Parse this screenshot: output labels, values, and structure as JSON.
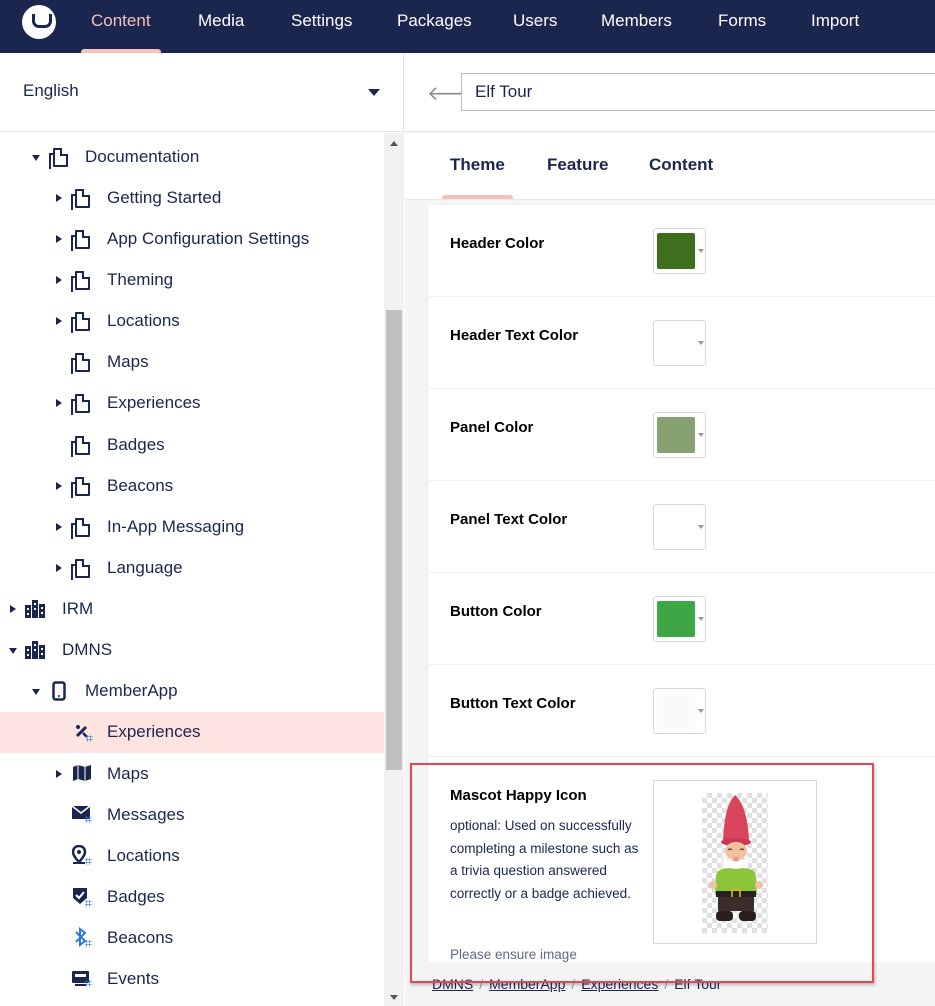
{
  "topnav": {
    "items": [
      "Content",
      "Media",
      "Settings",
      "Packages",
      "Users",
      "Members",
      "Forms",
      "Import"
    ],
    "active": "Content"
  },
  "sidebar": {
    "language": "English",
    "tree": [
      {
        "label": "Documentation",
        "icon": "document-icon",
        "expanded": true
      },
      {
        "label": "Getting Started",
        "icon": "document-icon",
        "has_children": true
      },
      {
        "label": "App Configuration Settings",
        "icon": "document-icon",
        "has_children": true
      },
      {
        "label": "Theming",
        "icon": "document-icon",
        "has_children": true
      },
      {
        "label": "Locations",
        "icon": "document-icon",
        "has_children": true
      },
      {
        "label": "Maps",
        "icon": "document-icon",
        "has_children": false
      },
      {
        "label": "Experiences",
        "icon": "document-icon",
        "has_children": true
      },
      {
        "label": "Badges",
        "icon": "document-icon",
        "has_children": false
      },
      {
        "label": "Beacons",
        "icon": "document-icon",
        "has_children": true
      },
      {
        "label": "In-App Messaging",
        "icon": "document-icon",
        "has_children": true
      },
      {
        "label": "Language",
        "icon": "document-icon",
        "has_children": true
      },
      {
        "label": "IRM",
        "icon": "building-icon",
        "has_children": true
      },
      {
        "label": "DMNS",
        "icon": "building-icon",
        "expanded": true
      },
      {
        "label": "MemberApp",
        "icon": "mobile-icon",
        "expanded": true
      },
      {
        "label": "Experiences",
        "icon": "experiences-icon",
        "selected": true
      },
      {
        "label": "Maps",
        "icon": "map-icon",
        "has_children": true
      },
      {
        "label": "Messages",
        "icon": "envelope-icon"
      },
      {
        "label": "Locations",
        "icon": "location-pin-icon"
      },
      {
        "label": "Badges",
        "icon": "badge-icon"
      },
      {
        "label": "Beacons",
        "icon": "bluetooth-icon"
      },
      {
        "label": "Events",
        "icon": "events-icon"
      }
    ]
  },
  "editor": {
    "name": "Elf Tour",
    "tabs": [
      "Theme",
      "Feature",
      "Content"
    ],
    "active_tab": "Theme",
    "properties": [
      {
        "label": "Header Color",
        "color": "#3f6e1d"
      },
      {
        "label": "Header Text Color",
        "color": "#ffffff"
      },
      {
        "label": "Panel Color",
        "color": "#87a173"
      },
      {
        "label": "Panel Text Color",
        "color": "#ffffff"
      },
      {
        "label": "Button Color",
        "color": "#3fa646"
      },
      {
        "label": "Button Text Color",
        "color": "#fafafa"
      }
    ],
    "mascot": {
      "label": "Mascot Happy Icon",
      "description": "optional: Used on successfully completing a milestone such as a trivia question answered correctly or a badge achieved.",
      "more": "Please ensure image"
    }
  },
  "breadcrumb": [
    "DMNS",
    "MemberApp",
    "Experiences",
    "Elf Tour"
  ],
  "accent_color": "#f5c1bc",
  "highlight_color": "#e4474f"
}
